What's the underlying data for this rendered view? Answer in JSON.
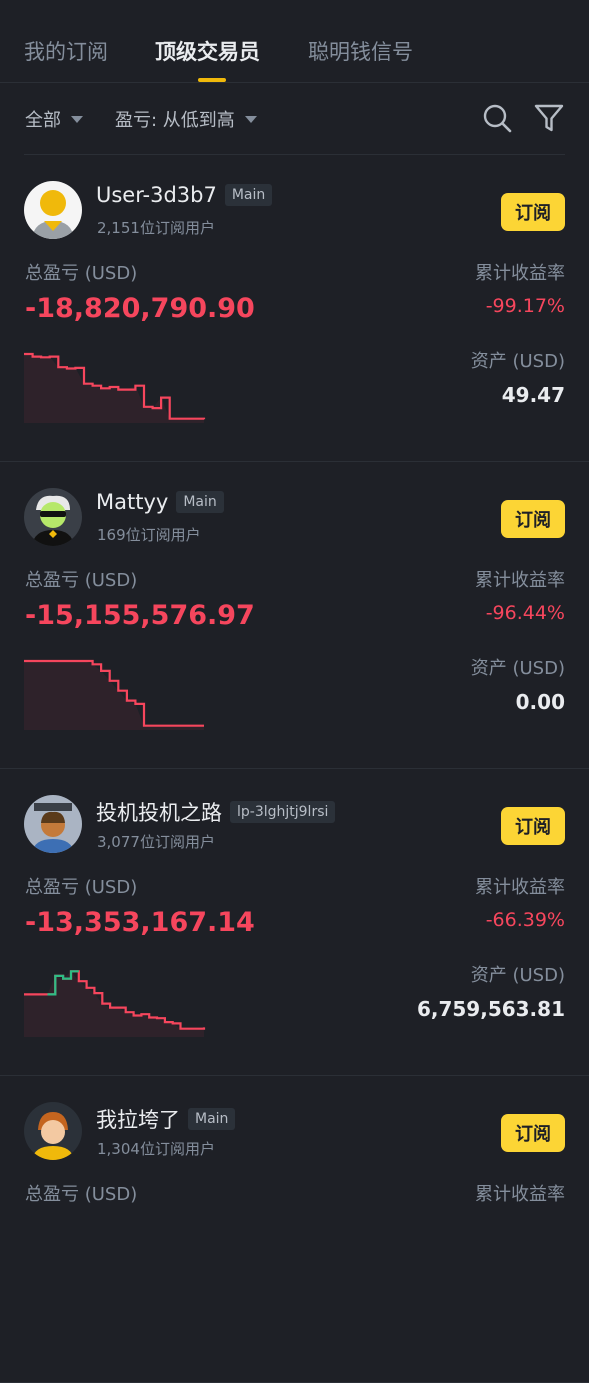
{
  "tabs": [
    {
      "label": "我的订阅"
    },
    {
      "label": "顶级交易员"
    },
    {
      "label": "聪明钱信号"
    }
  ],
  "filters": {
    "scope": "全部",
    "sort": "盈亏: 从低到高",
    "icons": [
      "search-icon",
      "filter-icon"
    ]
  },
  "common": {
    "subscribe_label": "订阅",
    "pnl_label": "总盈亏 (USD)",
    "roi_label": "累计收益率",
    "asset_label": "资产 (USD)"
  },
  "colors": {
    "accent": "#fcd535",
    "negative": "#f6465d",
    "positive": "#2ebd85",
    "background": "#1e2026"
  },
  "traders": [
    {
      "name": "User-3d3b7",
      "tag": "Main",
      "subscribers": "2,151位订阅用户",
      "pnl": "-18,820,790.90",
      "roi": "-99.17%",
      "assets": "49.47",
      "avatar": "default-yellow-avatar",
      "spark": [
        100,
        96,
        95,
        96,
        80,
        78,
        79,
        55,
        52,
        48,
        50,
        46,
        46,
        52,
        20,
        18,
        34,
        2,
        2,
        2,
        2,
        1
      ]
    },
    {
      "name": "Mattyy",
      "tag": "Main",
      "subscribers": "169位订阅用户",
      "pnl": "-15,155,576.97",
      "roi": "-96.44%",
      "assets": "0.00",
      "avatar": "sunglasses-avatar",
      "spark": [
        100,
        100,
        100,
        100,
        100,
        100,
        100,
        100,
        95,
        85,
        70,
        55,
        40,
        35,
        2,
        2,
        2,
        2,
        2,
        2,
        2,
        2
      ]
    },
    {
      "name": "投机投机之路",
      "tag": "lp-3lghjtj9lrsi",
      "subscribers": "3,077位订阅用户",
      "pnl": "-13,353,167.14",
      "roi": "-66.39%",
      "assets": "6,759,563.81",
      "avatar": "graduate-avatar",
      "spark": [
        60,
        60,
        60,
        60,
        88,
        84,
        95,
        80,
        70,
        62,
        46,
        40,
        40,
        33,
        28,
        30,
        25,
        24,
        18,
        16,
        8,
        8,
        8,
        10
      ]
    },
    {
      "name": "我拉垮了",
      "tag": "Main",
      "subscribers": "1,304位订阅用户",
      "pnl": "",
      "roi": "",
      "assets": "",
      "avatar": "orange-hair-avatar",
      "spark": []
    }
  ]
}
